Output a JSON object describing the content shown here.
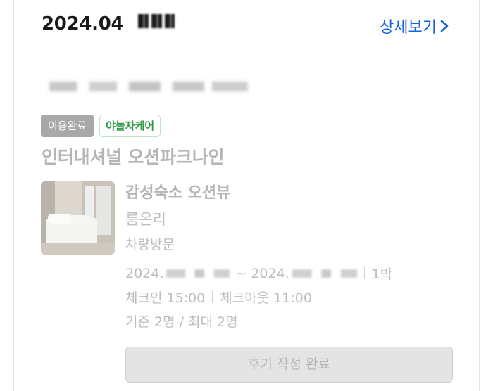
{
  "header": {
    "date": "2024.04",
    "detail_link": "상세보기"
  },
  "badges": {
    "status": "이용완료",
    "brand": "야놀자케어"
  },
  "hotel": {
    "name": "인터내셔널 오션파크나인"
  },
  "room": {
    "title": "감성숙소 오션뷰",
    "type": "룸온리",
    "visit": "차량방문"
  },
  "stay": {
    "start_prefix": "2024.",
    "range_sep": "~",
    "end_prefix": "2024.",
    "nights": "1박",
    "checkin": "체크인 15:00",
    "checkout": "체크아웃 11:00",
    "capacity": "기준 2명 / 최대 2명"
  },
  "review_button": "후기 작성 완료",
  "icons": {
    "detail_arrow": "chevron-right-icon"
  },
  "colors": {
    "accent": "#1764d8",
    "brand": "#2f9a45",
    "status_badge": "#a8a8a8"
  }
}
